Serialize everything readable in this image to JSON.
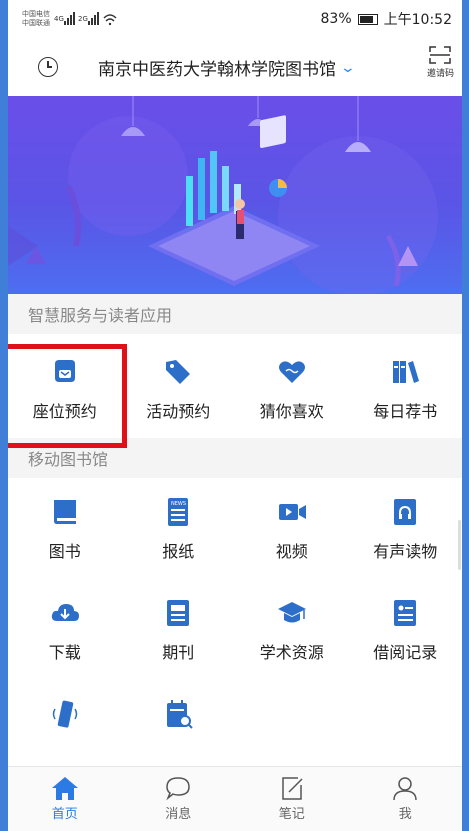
{
  "status_bar": {
    "carrier1": "中国电信",
    "carrier2": "中国联通",
    "battery": "83%",
    "time": "上午10:52"
  },
  "header": {
    "title": "南京中医药大学翰林学院图书馆",
    "invite_label": "邀请码"
  },
  "sections": {
    "services": {
      "title": "智慧服务与读者应用",
      "items": [
        {
          "label": "座位预约",
          "icon": "seat-icon"
        },
        {
          "label": "活动预约",
          "icon": "tag-icon"
        },
        {
          "label": "猜你喜欢",
          "icon": "heart-icon"
        },
        {
          "label": "每日荐书",
          "icon": "books-icon"
        }
      ]
    },
    "mobile": {
      "title": "移动图书馆",
      "items": [
        {
          "label": "图书",
          "icon": "book-icon"
        },
        {
          "label": "报纸",
          "icon": "newspaper-icon"
        },
        {
          "label": "视频",
          "icon": "video-icon"
        },
        {
          "label": "有声读物",
          "icon": "audiobook-icon"
        },
        {
          "label": "下载",
          "icon": "cloud-download-icon"
        },
        {
          "label": "期刊",
          "icon": "journal-icon"
        },
        {
          "label": "学术资源",
          "icon": "graduation-cap-icon"
        },
        {
          "label": "借阅记录",
          "icon": "borrow-record-icon"
        },
        {
          "label": "",
          "icon": "phone-vibrate-icon"
        },
        {
          "label": "",
          "icon": "calendar-search-icon"
        }
      ]
    }
  },
  "tabs": [
    {
      "label": "首页",
      "icon": "home-icon"
    },
    {
      "label": "消息",
      "icon": "message-icon"
    },
    {
      "label": "笔记",
      "icon": "note-icon"
    },
    {
      "label": "我",
      "icon": "user-icon"
    }
  ],
  "colors": {
    "accent": "#2c7be5",
    "icon": "#2d6fc8",
    "highlight": "#e0101a",
    "banner": "#6a4ee8"
  }
}
